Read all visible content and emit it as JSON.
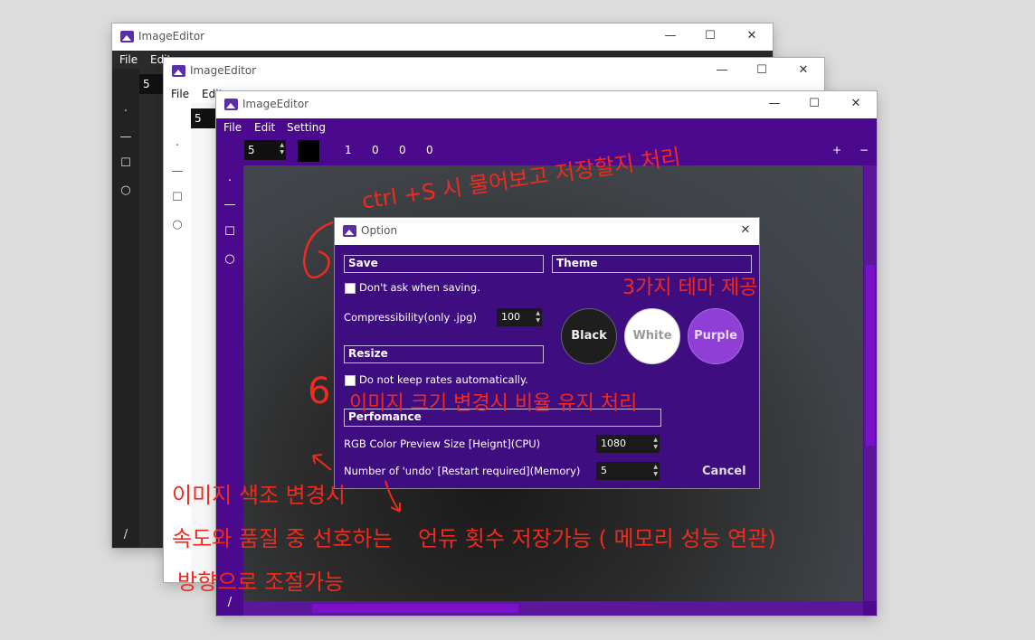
{
  "app": {
    "title": "ImageEditor"
  },
  "menu": [
    "File",
    "Edit",
    "Setting"
  ],
  "back_menu": [
    "File",
    "Edit"
  ],
  "toolbar": {
    "brush_size": "5",
    "values": [
      "1",
      "0",
      "0",
      "0"
    ],
    "zoom_in": "+",
    "zoom_out": "−"
  },
  "tools": {
    "dot": "·",
    "line": "—",
    "rect": "☐",
    "ellipse": "○",
    "pen": "/"
  },
  "window_controls": {
    "minimize": "—",
    "maximize": "☐",
    "close": "✕"
  },
  "option_dialog": {
    "title": "Option",
    "save": {
      "header": "Save",
      "dont_ask_label": "Don't ask when saving.",
      "compress_label": "Compressibility(only .jpg)",
      "compress_value": "100"
    },
    "theme": {
      "header": "Theme",
      "options": [
        "Black",
        "White",
        "Purple"
      ]
    },
    "resize": {
      "header": "Resize",
      "keep_rates_label": "Do not keep rates automatically."
    },
    "performance": {
      "header": "Perfomance",
      "rgb_label": "RGB Color Preview Size [Heignt](CPU)",
      "rgb_value": "1080",
      "undo_label": "Number of 'undo' [Restart required](Memory)",
      "undo_value": "5"
    },
    "cancel_label": "Cancel"
  },
  "annotations": {
    "ctrl_s": "ctrl +S 시 물어보고 저장할지 처리",
    "themes": "3가지 테마 제공",
    "resize_note": "이미지 크기 변경시 비율 유지 처리",
    "preview_1": "이미지 색조 변경시",
    "preview_2": "속도와 품질 중 선호하는",
    "preview_3": "방향으로 조절가능",
    "undo_note": "언듀 횟수 저장가능 ( 메모리 성능 연관)",
    "six": "6"
  },
  "colors": {
    "accent": "#4b0a8e",
    "dialog": "#3e0d80",
    "annotation": "#f02a1e"
  }
}
